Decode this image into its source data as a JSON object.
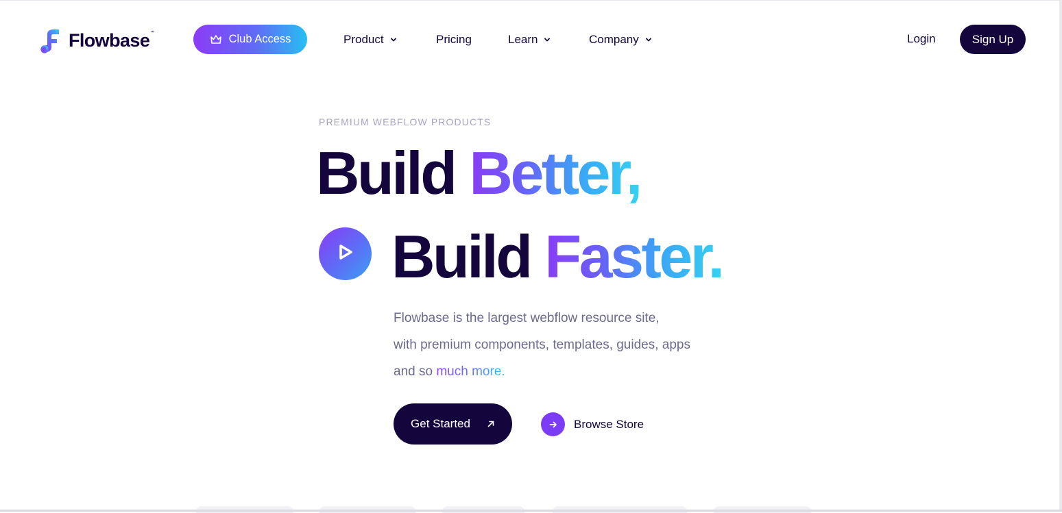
{
  "nav": {
    "logo_text": "Flowbase",
    "logo_tm": "™",
    "club_label": "Club Access",
    "links": [
      {
        "label": "Product",
        "has_dropdown": true
      },
      {
        "label": "Pricing",
        "has_dropdown": false
      },
      {
        "label": "Learn",
        "has_dropdown": true
      },
      {
        "label": "Company",
        "has_dropdown": true
      }
    ],
    "login_label": "Login",
    "signup_label": "Sign Up"
  },
  "hero": {
    "eyebrow": "PREMIUM WEBFLOW PRODUCTS",
    "line1_dark": "Build ",
    "line1_grad": "Better,",
    "line2_dark": "Build ",
    "line2_grad": "Faster.",
    "desc_line1": "Flowbase is the largest webflow resource site,",
    "desc_line2": "with premium components, templates, guides, apps",
    "desc_line3_plain": "and so ",
    "desc_line3_grad": "much more.",
    "cta_label": "Get Started",
    "browse_label": "Browse Store"
  },
  "colors": {
    "brand_dark": "#14063d",
    "accent_purple": "#8a3cf6",
    "accent_cyan": "#35d2f2",
    "muted_text": "#6c6a8e",
    "eyebrow_text": "#a7a3c4"
  },
  "icons": {
    "logo": "flowbase-logo-icon",
    "club": "crown-icon",
    "dropdown": "chevron-down-icon",
    "play": "play-icon",
    "cta": "arrow-up-right-icon",
    "browse": "arrow-right-icon"
  }
}
